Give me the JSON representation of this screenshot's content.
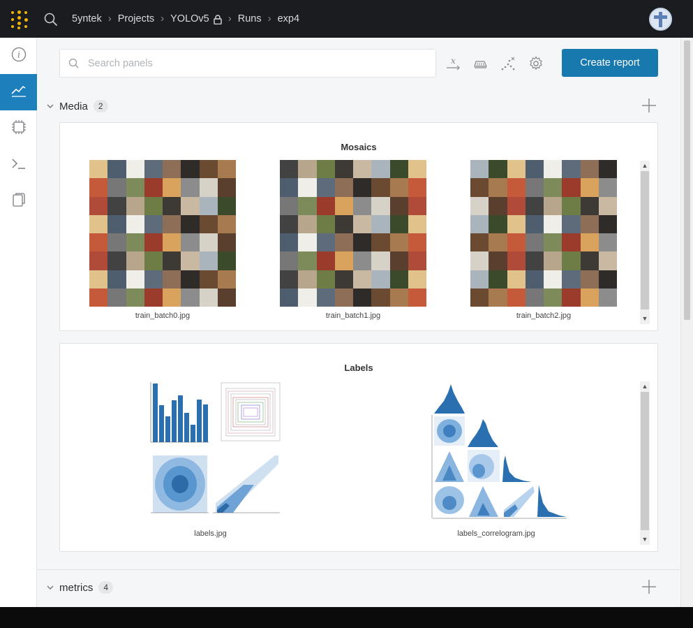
{
  "topbar": {
    "breadcrumb": [
      "5yntek",
      "Projects",
      "YOLOv5",
      "Runs",
      "exp4"
    ]
  },
  "sidebar": {
    "items": [
      {
        "name": "info-icon",
        "active": false
      },
      {
        "name": "charts-icon",
        "active": true
      },
      {
        "name": "system-icon",
        "active": false
      },
      {
        "name": "terminal-icon",
        "active": false
      },
      {
        "name": "files-icon",
        "active": false
      }
    ]
  },
  "toolbar": {
    "search_placeholder": "Search panels",
    "create_report_label": "Create report",
    "icons": [
      "x-axis-icon",
      "smoothing-icon",
      "outliers-icon",
      "settings-icon"
    ]
  },
  "sections": {
    "media": {
      "label": "Media",
      "count": "2"
    },
    "metrics": {
      "label": "metrics",
      "count": "4"
    }
  },
  "panels": {
    "mosaics": {
      "title": "Mosaics",
      "images": [
        "train_batch0.jpg",
        "train_batch1.jpg",
        "train_batch2.jpg"
      ]
    },
    "labels": {
      "title": "Labels",
      "images": [
        "labels.jpg",
        "labels_correlogram.jpg"
      ]
    }
  },
  "colors": {
    "accent": "#1779ad",
    "topbar": "#1a1c1f",
    "logo": "#f4b400",
    "histogram": "#2a6fb0"
  }
}
